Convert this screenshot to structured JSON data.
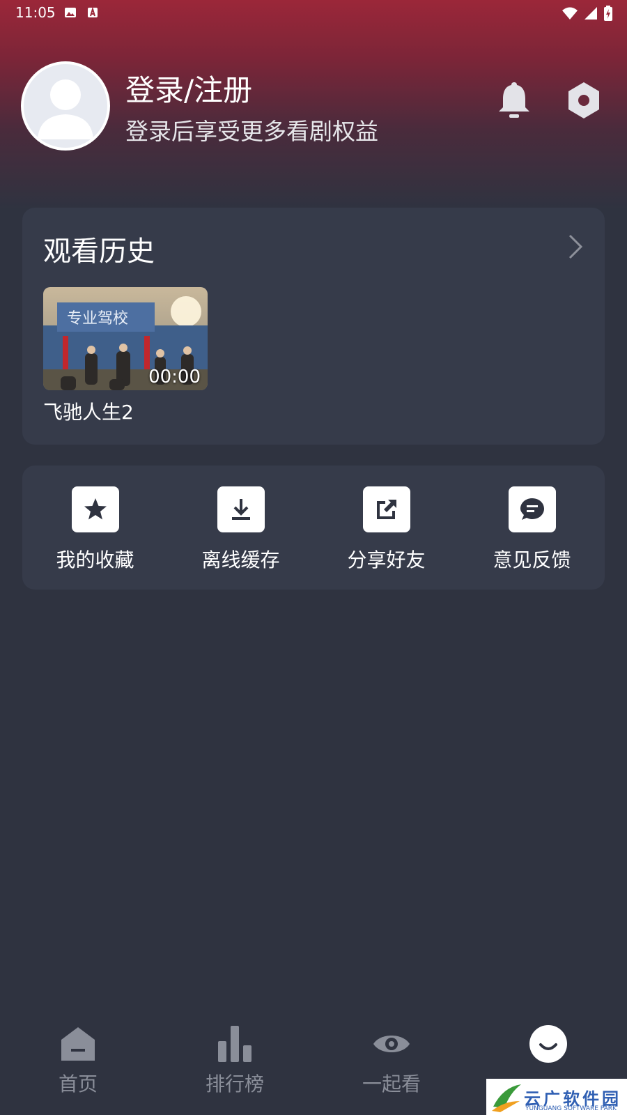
{
  "status_bar": {
    "time": "11:05"
  },
  "profile": {
    "title": "登录/注册",
    "subtitle": "登录后享受更多看剧权益"
  },
  "history": {
    "title": "观看历史",
    "items": [
      {
        "name": "飞驰人生2",
        "time": "00:00",
        "thumb_sign": "专业驾校"
      }
    ]
  },
  "actions": [
    {
      "label": "我的收藏",
      "icon": "star-icon"
    },
    {
      "label": "离线缓存",
      "icon": "download-icon"
    },
    {
      "label": "分享好友",
      "icon": "share-icon"
    },
    {
      "label": "意见反馈",
      "icon": "feedback-icon"
    }
  ],
  "tabs": [
    {
      "label": "首页",
      "icon": "home-icon"
    },
    {
      "label": "排行榜",
      "icon": "bar-chart-icon"
    },
    {
      "label": "一起看",
      "icon": "eye-icon"
    },
    {
      "label": "",
      "icon": "smile-icon"
    }
  ],
  "watermark": {
    "text": "云广软件园",
    "sub": "YUNGUANG SOFTWARE PARK"
  },
  "colors": {
    "background": "#2f3340",
    "card": "#363b4a",
    "header_red": "#9b2739",
    "tab_inactive": "#8a8e99"
  }
}
